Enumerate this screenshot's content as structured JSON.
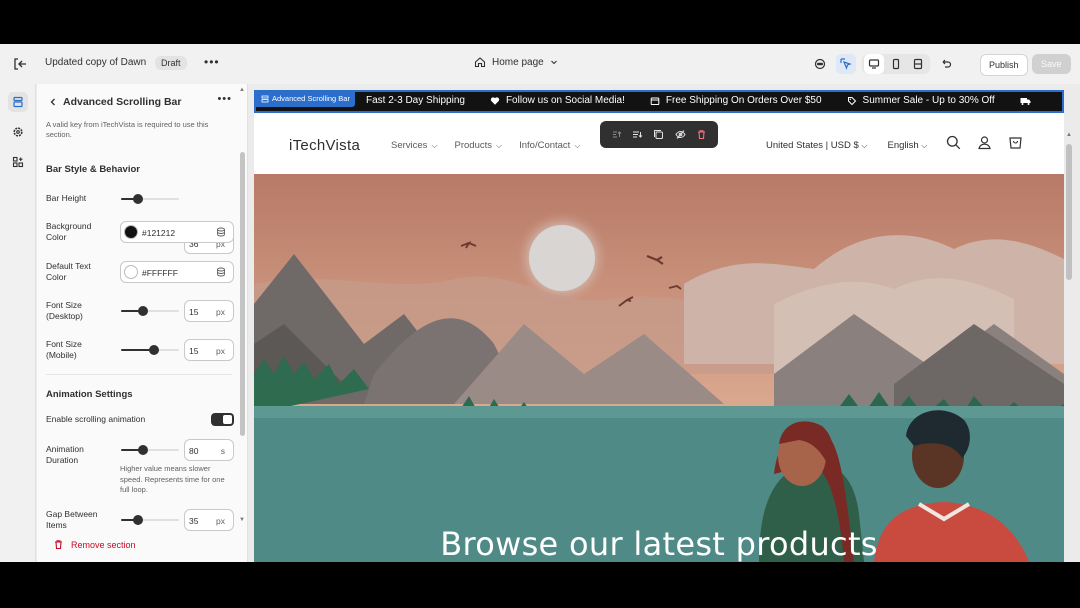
{
  "topbar": {
    "store_title": "Updated copy of Dawn",
    "status_badge": "Draft",
    "more": "•••",
    "page_selector": "Home page",
    "publish_label": "Publish",
    "save_label": "Save"
  },
  "panel": {
    "title": "Advanced Scrolling Bar",
    "more": "•••",
    "note": "A valid key from iTechVista is required to use this section.",
    "bar_style": {
      "heading": "Bar Style & Behavior",
      "bar_height": {
        "label": "Bar Height",
        "value": "36",
        "unit": "px",
        "level": 0.3
      },
      "background_color": {
        "label": "Background Color",
        "hex": "#121212",
        "swatch": "#121212"
      },
      "default_text_color": {
        "label": "Default Text Color",
        "hex": "#FFFFFF",
        "swatch": "#ffffff"
      },
      "font_size_desktop": {
        "label": "Font Size (Desktop)",
        "value": "15",
        "unit": "px",
        "level": 0.38
      },
      "font_size_mobile": {
        "label": "Font Size (Mobile)",
        "value": "15",
        "unit": "px",
        "level": 0.57
      }
    },
    "animation": {
      "heading": "Animation Settings",
      "enable_label": "Enable scrolling animation",
      "enabled": true,
      "duration": {
        "label": "Animation Duration",
        "value": "80",
        "unit": "s",
        "level": 0.38
      },
      "duration_help": "Higher value means slower speed. Represents time for one full loop.",
      "gap": {
        "label": "Gap Between Items",
        "value": "35",
        "unit": "px",
        "level": 0.3
      }
    },
    "remove_label": "Remove section"
  },
  "preview": {
    "section_tag": "Advanced Scrolling Bar",
    "announcements": [
      {
        "icon": "truck-icon",
        "text": "Fast 2-3 Day Shipping"
      },
      {
        "icon": "heart-icon",
        "text": "Follow us on Social Media!"
      },
      {
        "icon": "box-icon",
        "text": "Free Shipping On Orders Over $50"
      },
      {
        "icon": "tag-icon",
        "text": "Summer Sale - Up to 30% Off"
      }
    ],
    "logo": "iTechVista",
    "nav": [
      "Services",
      "Products",
      "Info/Contact"
    ],
    "country": "United States | USD $",
    "language": "English",
    "hero_title": "Browse our latest products"
  },
  "colors": {
    "accent": "#2c6ecb",
    "bar_bg": "#121212",
    "danger": "#c70a24"
  }
}
